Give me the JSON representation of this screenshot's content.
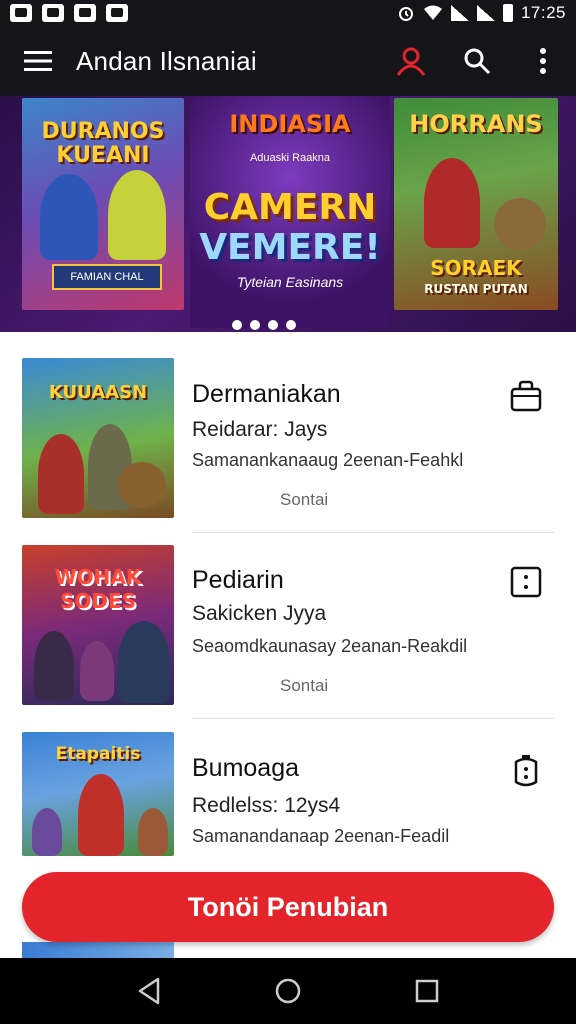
{
  "status_bar": {
    "time": "17:25"
  },
  "app_bar": {
    "title": "Andan Ilsnaniai",
    "icons": [
      "menu-icon",
      "user-icon",
      "search-icon",
      "more-vert-icon"
    ]
  },
  "banner": {
    "left_poster": {
      "title": "DURANOS KUEANI",
      "caption": "FAMIAN CHAL"
    },
    "center_poster": {
      "logo": "INDIASIA",
      "tagline": "Aduaski Raakna",
      "headline_1": "CAMERN",
      "headline_2": "VEMERE!",
      "subtitle": "Tyteian Easinans"
    },
    "right_poster": {
      "title": "HORRANS",
      "subtitle_1": "SORAEK",
      "subtitle_2": "RUSTAN PUTAN"
    },
    "page_count": 4
  },
  "games": [
    {
      "thumb_title": "KUUAASN",
      "name": "Dermaniakan",
      "subtitle": "Reidarar: Jays",
      "description": "Samanankanaaug 2eenan-Feahkl",
      "status": "Sontai",
      "action_icon": "bag-icon"
    },
    {
      "thumb_title": "WOHAK SODES",
      "name": "Pediarin",
      "subtitle": "Sakicken Jyya",
      "description": "Seaomdkaunasay 2eanan-Reakdil",
      "status": "Sontai",
      "action_icon": "dots-box-icon"
    },
    {
      "thumb_title": "Etapaitis",
      "name": "Bumoaga",
      "subtitle": "Redlelss: 12ys4",
      "description": "Samanandanaap 2eenan-Feadil",
      "action_icon": "timer-bag-icon"
    }
  ],
  "primary_button": {
    "label": "Tonöi Penubian"
  },
  "colors": {
    "accent": "#e3242b",
    "bar_bg": "#141419"
  }
}
